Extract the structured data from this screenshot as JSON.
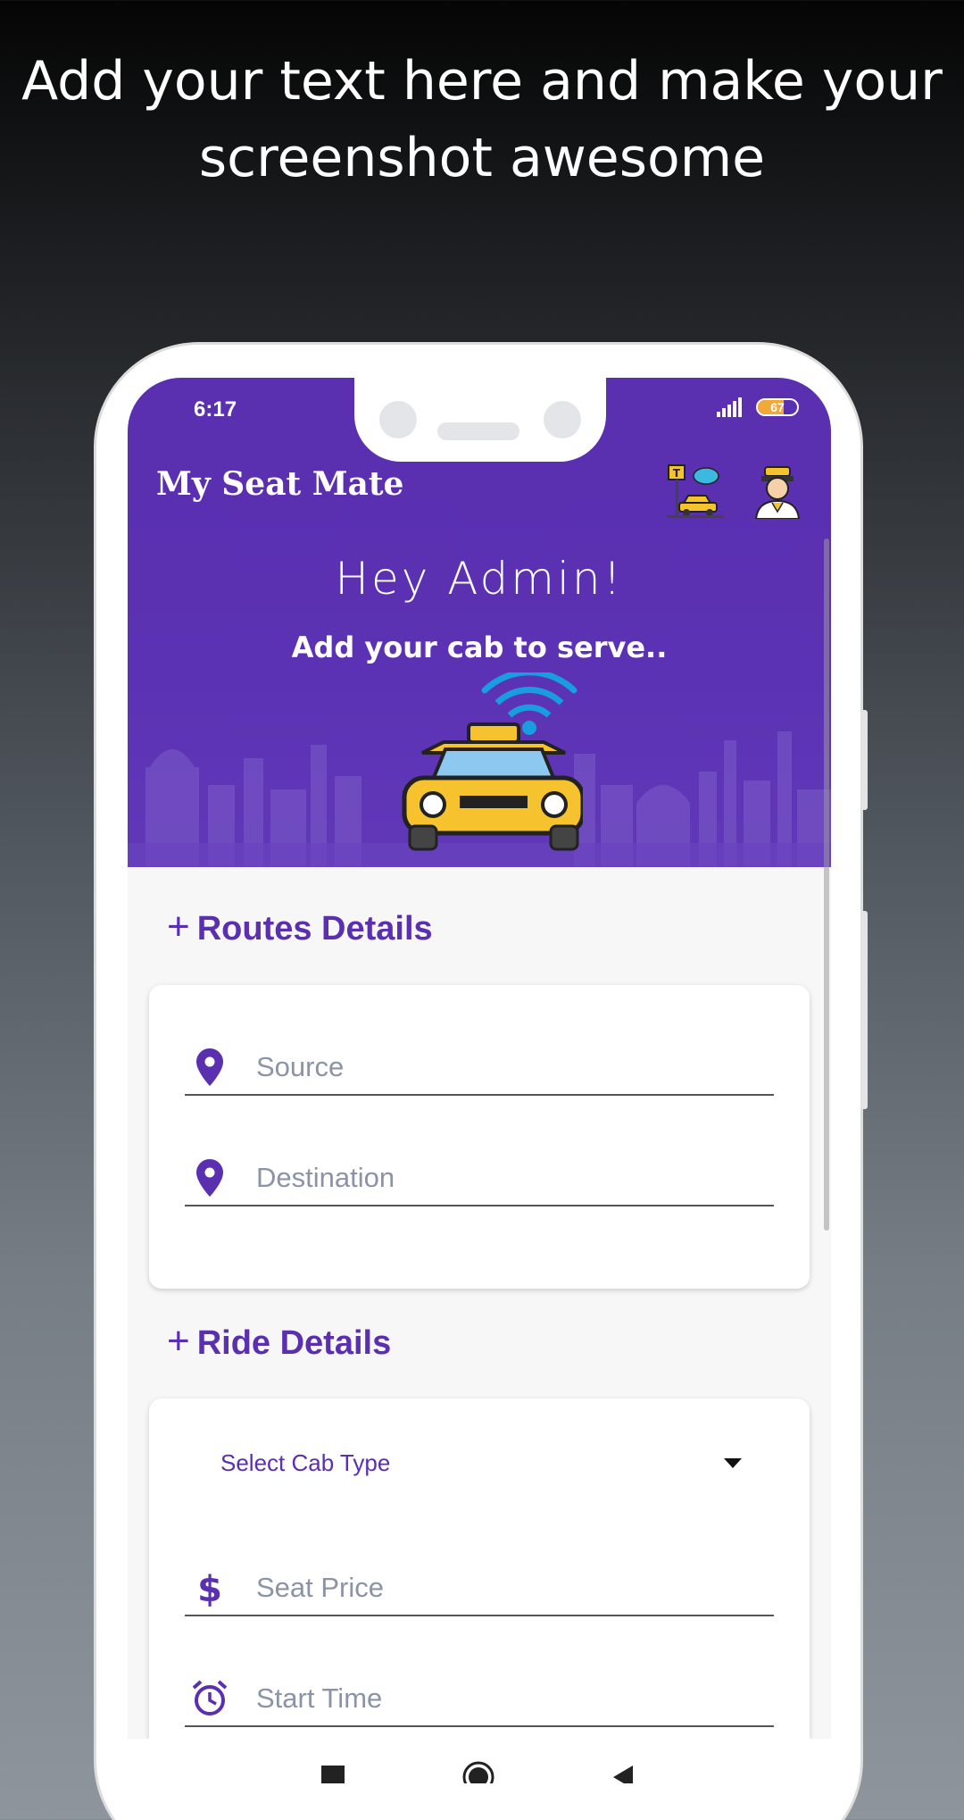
{
  "promo": {
    "headline_line1": "Add your text here and make your",
    "headline_line2": "screenshot awesome"
  },
  "status_bar": {
    "time": "6:17",
    "battery_level": "67",
    "battery_fraction": 0.67
  },
  "app": {
    "title": "My Seat Mate",
    "greeting": "Hey Admin!",
    "tagline": "Add your cab  to serve.."
  },
  "routes": {
    "heading_plus": "+",
    "heading": "Routes Details",
    "source_placeholder": "Source",
    "destination_placeholder": "Destination"
  },
  "ride": {
    "heading_plus": "+",
    "heading": "Ride Details",
    "cab_type_label": "Select Cab Type",
    "seat_price_placeholder": "Seat Price",
    "start_time_placeholder": "Start Time"
  },
  "colors": {
    "brand_purple": "#5a2fb0",
    "taxi_yellow": "#f6c22d",
    "placeholder_gray": "#8a94a6"
  },
  "icons": [
    "location-pin-icon",
    "dollar-icon",
    "alarm-clock-icon",
    "taxi-stand-icon",
    "taxi-driver-icon",
    "connected-taxi-icon",
    "dropdown-caret-icon",
    "nav-recents-icon",
    "nav-home-icon",
    "nav-back-icon"
  ]
}
